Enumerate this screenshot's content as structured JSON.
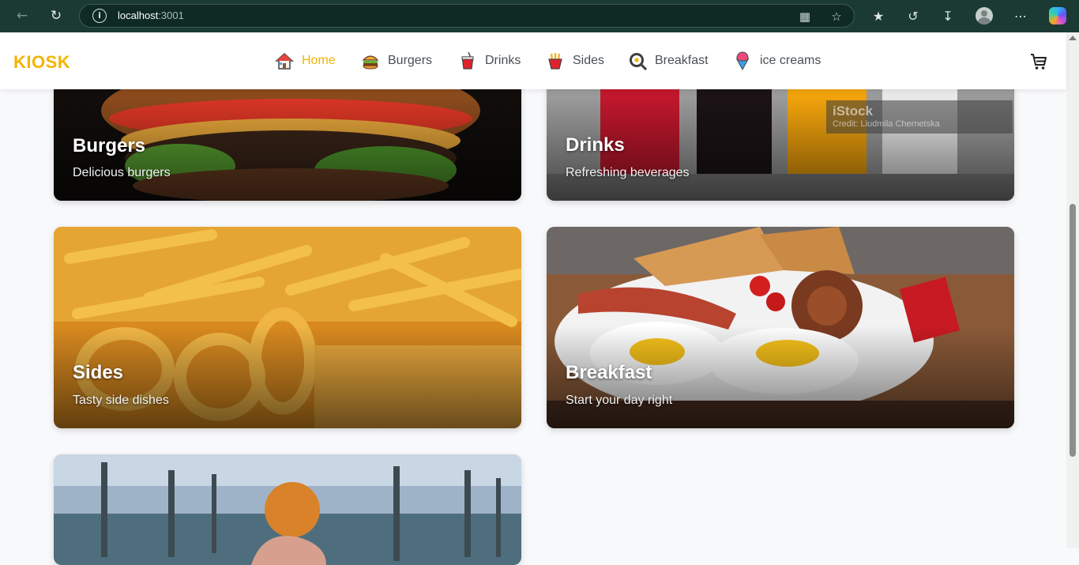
{
  "browser": {
    "url_host": "localhost",
    "url_port": ":3001"
  },
  "header": {
    "logo": "KIOSK",
    "nav": [
      {
        "label": "Home",
        "icon": "house-icon",
        "active": true
      },
      {
        "label": "Burgers",
        "icon": "burger-icon",
        "active": false
      },
      {
        "label": "Drinks",
        "icon": "drink-cup-icon",
        "active": false
      },
      {
        "label": "Sides",
        "icon": "fries-icon",
        "active": false
      },
      {
        "label": "Breakfast",
        "icon": "frying-pan-icon",
        "active": false
      },
      {
        "label": "ice creams",
        "icon": "ice-cream-icon",
        "active": false
      }
    ],
    "cart_icon": "cart-icon"
  },
  "categories": [
    {
      "title": "Burgers",
      "subtitle": "Delicious burgers"
    },
    {
      "title": "Drinks",
      "subtitle": "Refreshing beverages",
      "watermark_brand": "iStock",
      "watermark_credit": "Credit: Liudmila Chernetska"
    },
    {
      "title": "Sides",
      "subtitle": "Tasty side dishes"
    },
    {
      "title": "Breakfast",
      "subtitle": "Start your day right"
    },
    {
      "title": "",
      "subtitle": ""
    }
  ],
  "colors": {
    "accent": "#f4b400",
    "chrome": "#1c3a34"
  }
}
